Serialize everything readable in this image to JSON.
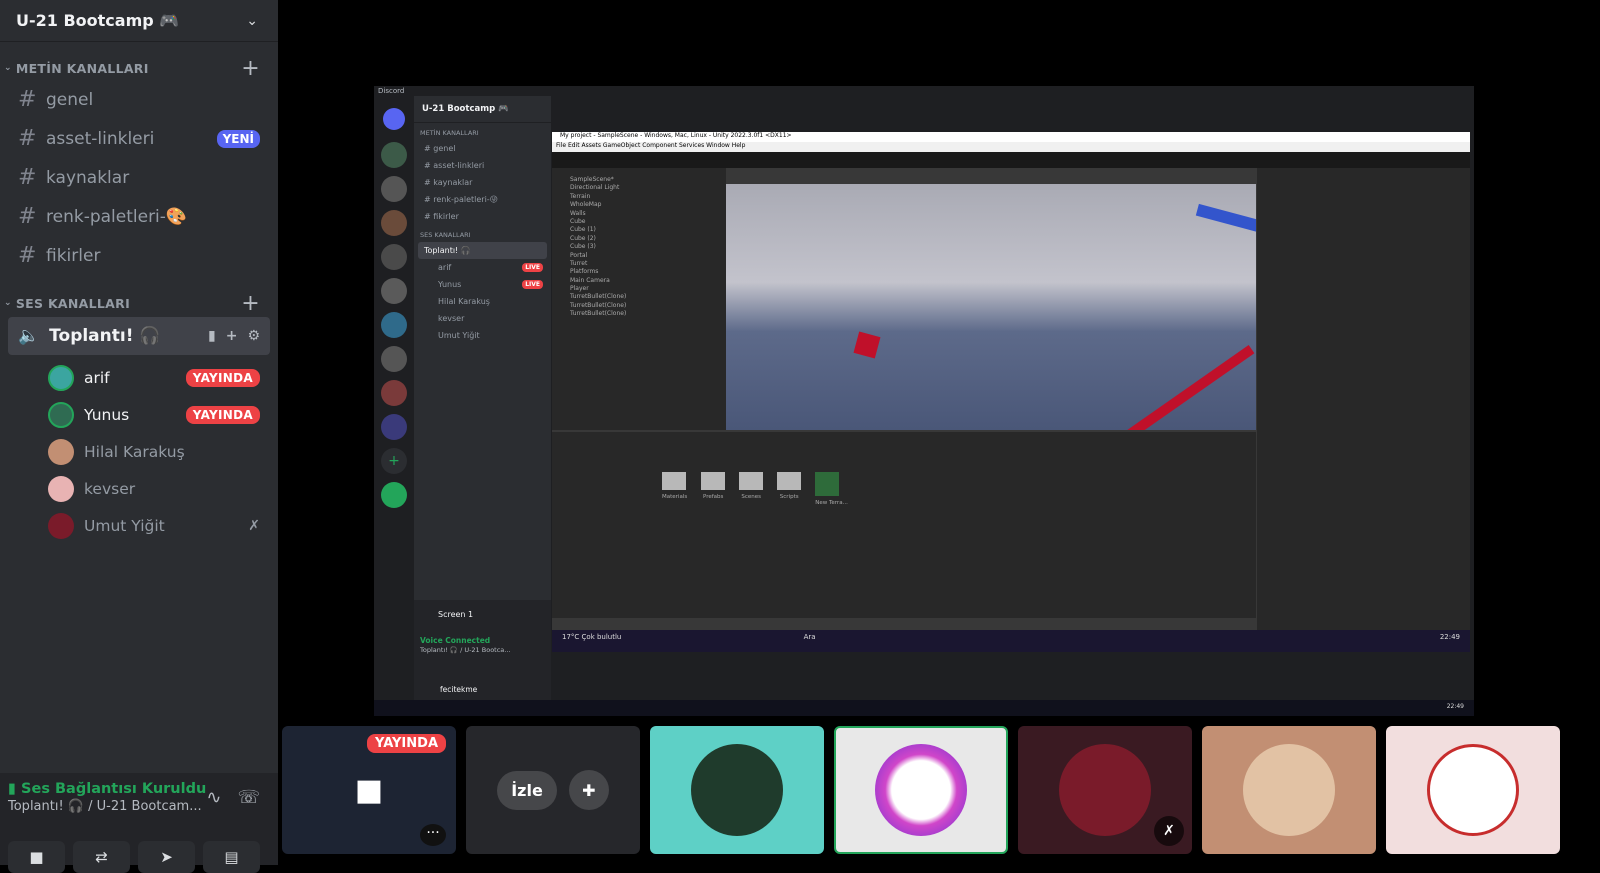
{
  "server": {
    "name": "U-21 Bootcamp 🎮"
  },
  "text_category": "METİN KANALLARI",
  "text_channels": [
    {
      "name": "genel",
      "badge": ""
    },
    {
      "name": "asset-linkleri",
      "badge": "YENİ"
    },
    {
      "name": "kaynaklar",
      "badge": ""
    },
    {
      "name": "renk-paletleri-🎨",
      "badge": ""
    },
    {
      "name": "fikirler",
      "badge": ""
    }
  ],
  "voice_category": "SES KANALLARI",
  "voice_channel": {
    "name": "Toplantı! 🎧"
  },
  "members": [
    {
      "name": "arif",
      "status": "YAYINDA",
      "color": "#3ba5a0"
    },
    {
      "name": "Yunus",
      "status": "YAYINDA",
      "color": "#2f6b52"
    },
    {
      "name": "Hilal Karakuş",
      "status": "",
      "color": "#c28f73"
    },
    {
      "name": "kevser",
      "status": "",
      "color": "#e8b3b3"
    },
    {
      "name": "Umut Yiğit",
      "status": "deafened",
      "color": "#7a1b2a"
    }
  ],
  "voice_panel": {
    "status": "Ses Bağlantısı Kuruldu",
    "channel": "Toplantı! 🎧 / U-21 Bootcam..."
  },
  "stream_mini": {
    "window_title": "Discord",
    "server": "U-21 Bootcamp 🎮",
    "text_cat": "METİN KANALLARI",
    "channels": [
      "genel",
      "asset-linkleri",
      "kaynaklar",
      "renk-paletleri-😜",
      "fikirler"
    ],
    "voice_cat": "SES KANALLARI",
    "voice_channel": "Toplantı! 🎧",
    "members": [
      "arif",
      "Yunus",
      "Hilal Karakuş",
      "kevser",
      "Umut Yiğit"
    ],
    "live": "LIVE",
    "screen": "Screen 1",
    "vc_status": "Voice Connected",
    "vc_channel": "Toplantı! 🎧 / U-21 Bootca...",
    "user": "fecitekme"
  },
  "unity": {
    "title": "My project - SampleScene - Windows, Mac, Linux - Unity 2022.3.0f1 <DX11>",
    "menu": "File   Edit   Assets   GameObject   Component   Services   Window   Help",
    "hierarchy": [
      "SampleScene*",
      "Directional Light",
      "Terrain",
      "WholeMap",
      "Walls",
      "Cube",
      "Cube (1)",
      "Cube (2)",
      "Cube (3)",
      "Portal",
      "Turret",
      "Platforms",
      "Main Camera",
      "Player",
      "TurretBullet(Clone)",
      "TurretBullet(Clone)",
      "TurretBullet(Clone)"
    ],
    "assets": [
      "Materials",
      "Prefabs",
      "Scenes",
      "Scripts",
      "New Terra..."
    ],
    "taskbar_search": "Ara",
    "weather": "17°C Çok bulutlu",
    "time": "22:49"
  },
  "tiles": {
    "live": "YAYINDA",
    "watch": "İzle"
  }
}
